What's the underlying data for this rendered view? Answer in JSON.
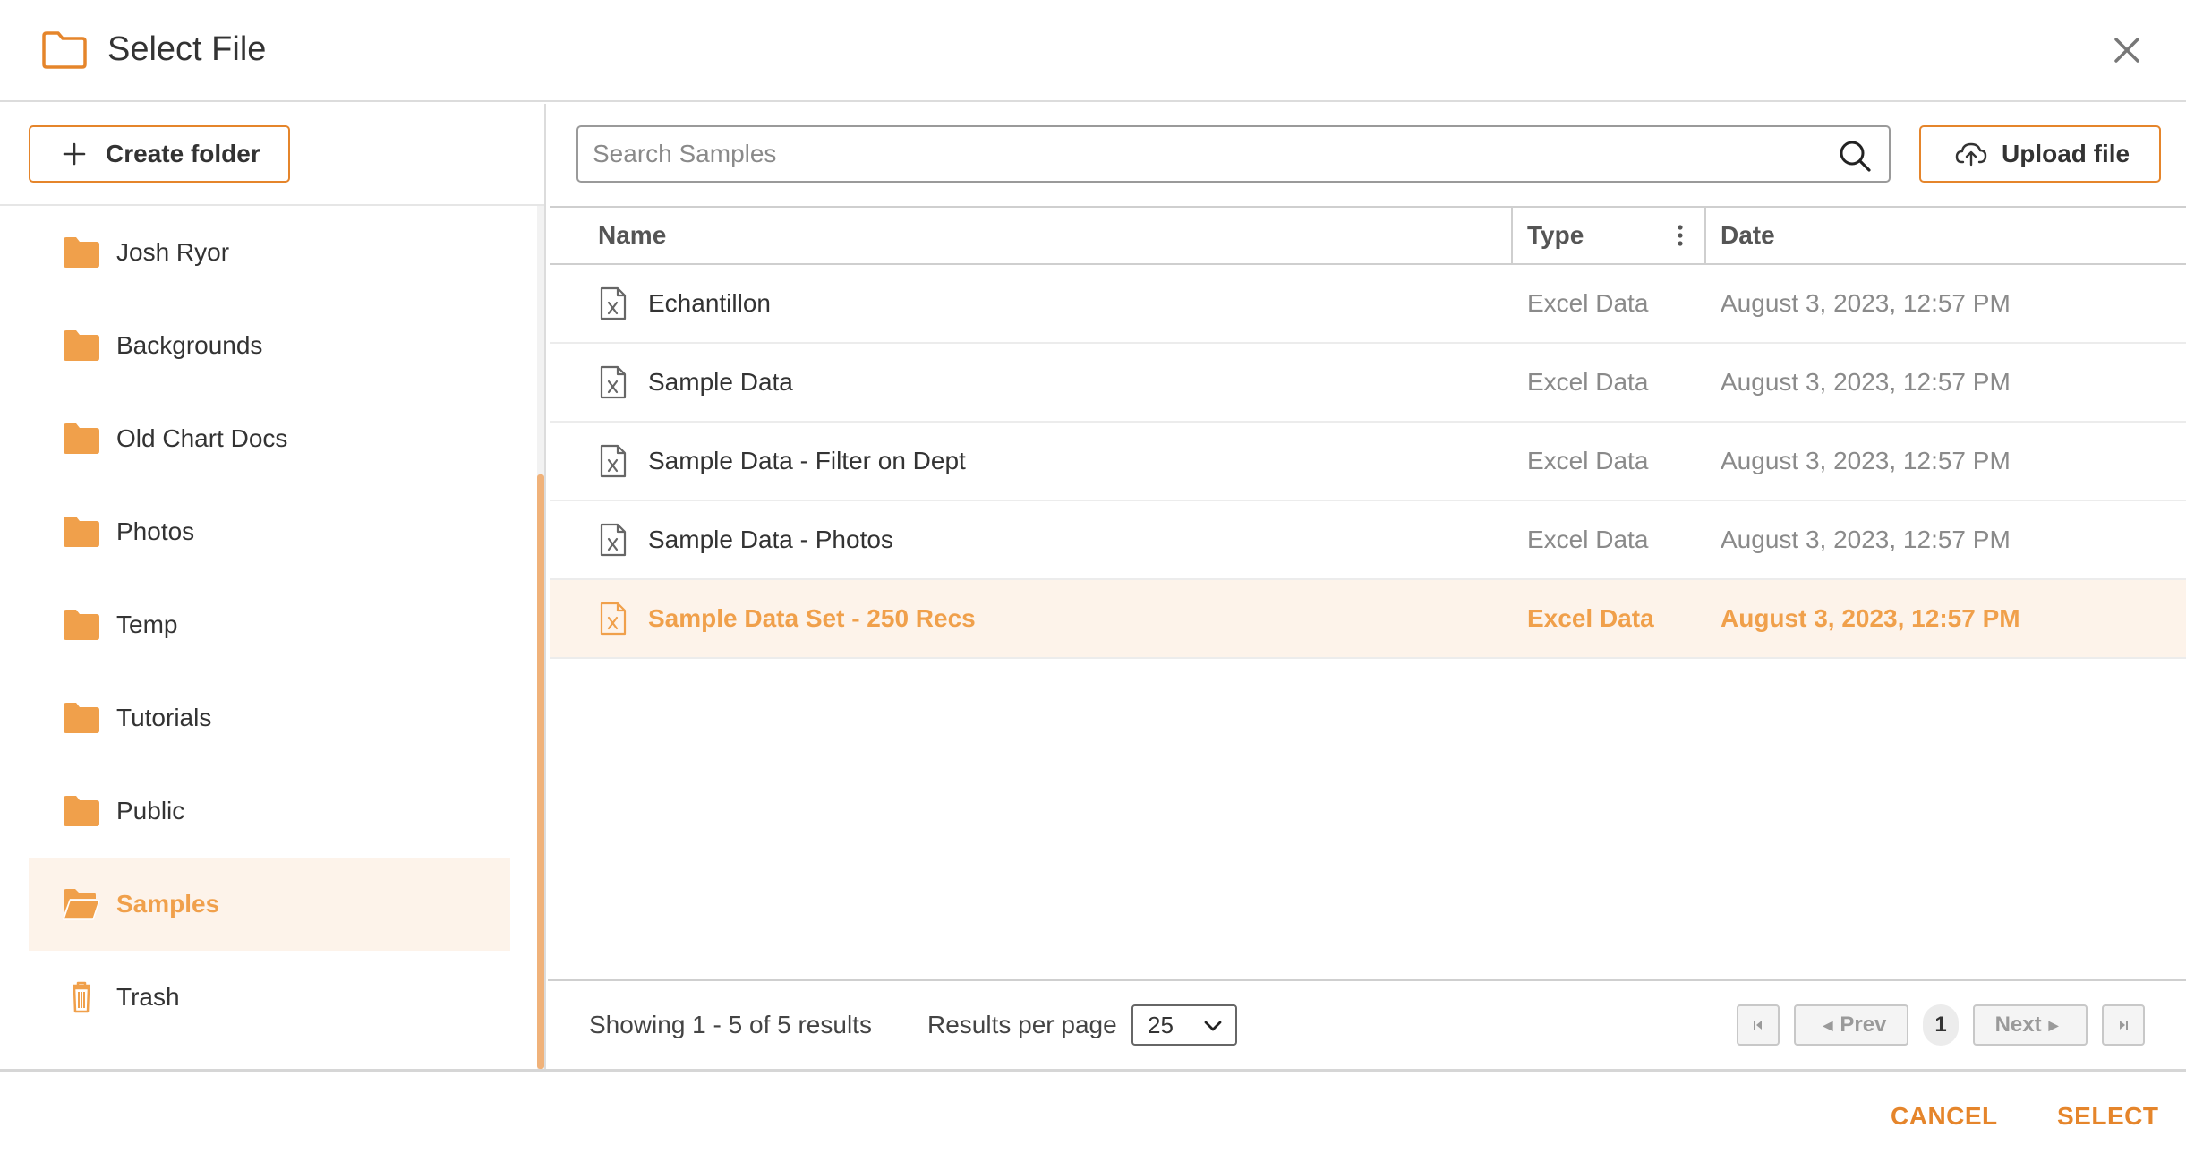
{
  "header": {
    "title": "Select File",
    "close_icon": "close-icon",
    "title_icon": "folder-outline-icon"
  },
  "sidebar": {
    "create_folder_label": "Create folder",
    "items": [
      {
        "label": "Josh Ryor",
        "icon": "folder-icon",
        "active": false
      },
      {
        "label": "Backgrounds",
        "icon": "folder-icon",
        "active": false
      },
      {
        "label": "Old Chart Docs",
        "icon": "folder-icon",
        "active": false
      },
      {
        "label": "Photos",
        "icon": "folder-icon",
        "active": false
      },
      {
        "label": "Temp",
        "icon": "folder-icon",
        "active": false
      },
      {
        "label": "Tutorials",
        "icon": "folder-icon",
        "active": false
      },
      {
        "label": "Public",
        "icon": "folder-icon",
        "active": false
      },
      {
        "label": "Samples",
        "icon": "folder-open-icon",
        "active": true
      },
      {
        "label": "Trash",
        "icon": "trash-icon",
        "active": false
      }
    ]
  },
  "search": {
    "placeholder": "Search Samples",
    "value": ""
  },
  "upload_label": "Upload file",
  "table": {
    "columns": {
      "name": "Name",
      "type": "Type",
      "date": "Date"
    },
    "rows": [
      {
        "name": "Echantillon",
        "type": "Excel Data",
        "date": "August 3, 2023, 12:57 PM",
        "selected": false
      },
      {
        "name": "Sample Data",
        "type": "Excel Data",
        "date": "August 3, 2023, 12:57 PM",
        "selected": false
      },
      {
        "name": "Sample Data - Filter on Dept",
        "type": "Excel Data",
        "date": "August 3, 2023, 12:57 PM",
        "selected": false
      },
      {
        "name": "Sample Data - Photos",
        "type": "Excel Data",
        "date": "August 3, 2023, 12:57 PM",
        "selected": false
      },
      {
        "name": "Sample Data Set - 250 Recs",
        "type": "Excel Data",
        "date": "August 3, 2023, 12:57 PM",
        "selected": true
      }
    ]
  },
  "pagination": {
    "showing": "Showing 1 - 5 of 5 results",
    "rpp_label": "Results per page",
    "rpp_value": "25",
    "prev_label": "Prev",
    "next_label": "Next",
    "current_page": "1"
  },
  "actions": {
    "cancel": "CANCEL",
    "select": "SELECT"
  },
  "colors": {
    "accent": "#e5852b",
    "accent_light": "#f0a04b",
    "selected_bg": "#fdf3ea"
  }
}
